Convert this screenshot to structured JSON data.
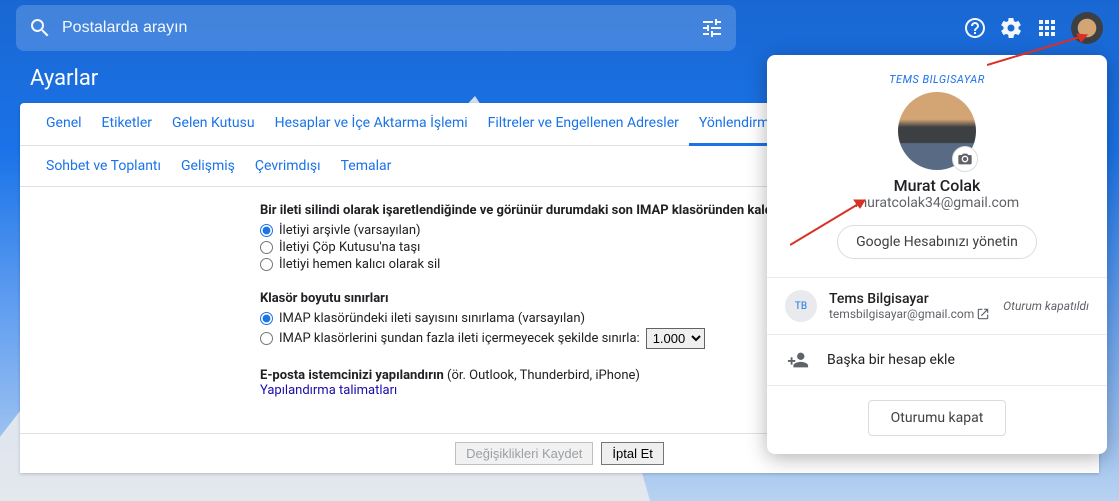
{
  "search": {
    "placeholder": "Postalarda arayın"
  },
  "page_title": "Ayarlar",
  "tabs_row1": [
    {
      "label": "Genel",
      "active": false
    },
    {
      "label": "Etiketler",
      "active": false
    },
    {
      "label": "Gelen Kutusu",
      "active": false
    },
    {
      "label": "Hesaplar ve İçe Aktarma İşlemi",
      "active": false
    },
    {
      "label": "Filtreler ve Engellenen Adresler",
      "active": false
    },
    {
      "label": "Yönlendirme ve POP/IMAP",
      "active": true
    }
  ],
  "tabs_row2": [
    {
      "label": "Sohbet ve Toplantı"
    },
    {
      "label": "Gelişmiş"
    },
    {
      "label": "Çevrimdışı"
    },
    {
      "label": "Temalar"
    }
  ],
  "imap_delete": {
    "heading": "Bir ileti silindi olarak işaretlendiğinde ve görünür durumdaki son IMAP klasöründen kaldırıldığında:",
    "opt_archive": "İletiyi arşivle (varsayılan)",
    "opt_trash": "İletiyi Çöp Kutusu'na taşı",
    "opt_delete": "İletiyi hemen kalıcı olarak sil"
  },
  "folder_limits": {
    "heading": "Klasör boyutu sınırları",
    "opt_no_limit": "IMAP klasöründeki ileti sayısını sınırlama (varsayılan)",
    "opt_limit": "IMAP klasörlerini şundan fazla ileti içermeyecek şekilde sınırla:",
    "select_value": "1.000"
  },
  "configure": {
    "heading": "E-posta istemcinizi yapılandırın",
    "hint": "(ör. Outlook, Thunderbird, iPhone)",
    "link": "Yapılandırma talimatları"
  },
  "actions": {
    "save": "Değişiklikleri Kaydet",
    "cancel": "İptal Et"
  },
  "account": {
    "brand": "TEMS BILGISAYAR",
    "name": "Murat Colak",
    "email": "muratcolak34@gmail.com",
    "manage": "Google Hesabınızı yönetin",
    "other": {
      "name": "Tems Bilgisayar",
      "email": "temsbilgisayar@gmail.com",
      "status": "Oturum kapatıldı"
    },
    "add": "Başka bir hesap ekle",
    "signout": "Oturumu kapat"
  }
}
